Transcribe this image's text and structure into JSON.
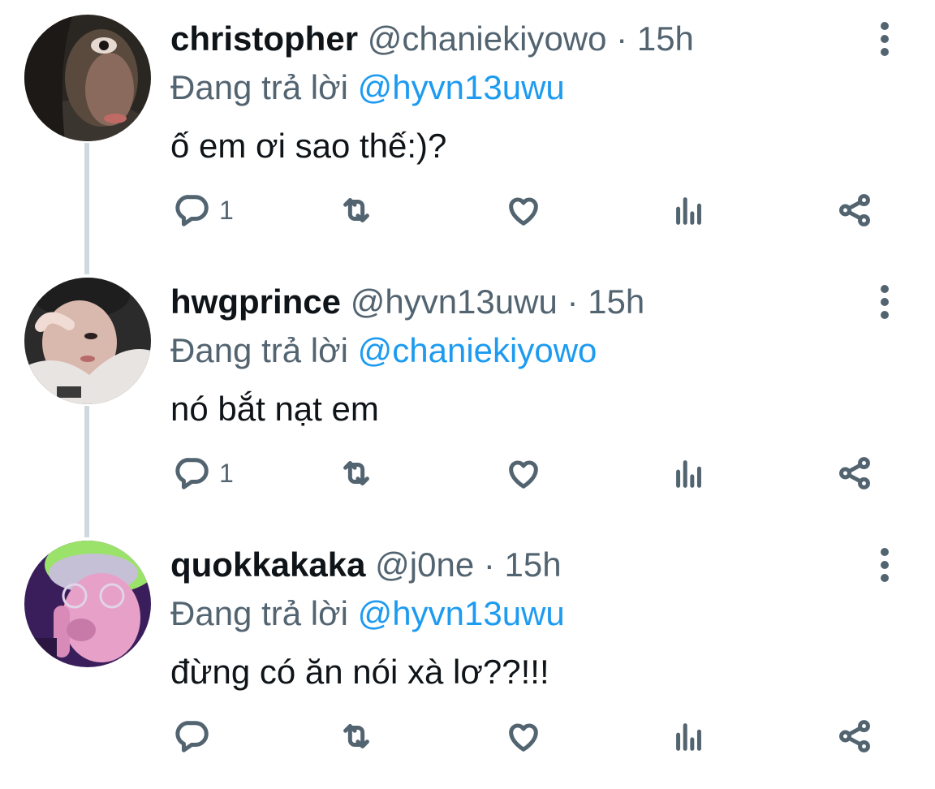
{
  "tweets": [
    {
      "name": "christopher",
      "handle": "@chaniekiyowo",
      "separator": "·",
      "time": "15h",
      "replying_prefix": "Đang trả lời",
      "replying_to": "@hyvn13uwu",
      "text": "ố em ơi sao thế:)?",
      "reply_count": "1",
      "avatar_colors": [
        "#2a2622",
        "#5a4a3e",
        "#a06a5c"
      ]
    },
    {
      "name": "hwgprince",
      "handle": "@hyvn13uwu",
      "separator": "·",
      "time": "15h",
      "replying_prefix": "Đang trả lời",
      "replying_to": "@chaniekiyowo",
      "text": "nó bắt nạt em",
      "reply_count": "1",
      "avatar_colors": [
        "#2b2b2b",
        "#e8e4e2",
        "#c9a79e"
      ]
    },
    {
      "name": "quokkakaka",
      "handle": "@j0ne",
      "separator": "·",
      "time": "15h",
      "replying_prefix": "Đang trả lời",
      "replying_to": "@hyvn13uwu",
      "text": "đừng có ăn nói xà lơ??!!!",
      "reply_count": "",
      "avatar_colors": [
        "#3a1e5c",
        "#9be26a",
        "#e7a0c8"
      ]
    }
  ],
  "colors": {
    "text": "#0f1419",
    "secondary": "#536471",
    "link": "#1d9bf0",
    "thread_line": "#cfd9de"
  },
  "icons": [
    "reply-icon",
    "retweet-icon",
    "like-icon",
    "analytics-icon",
    "share-icon",
    "more-icon"
  ]
}
